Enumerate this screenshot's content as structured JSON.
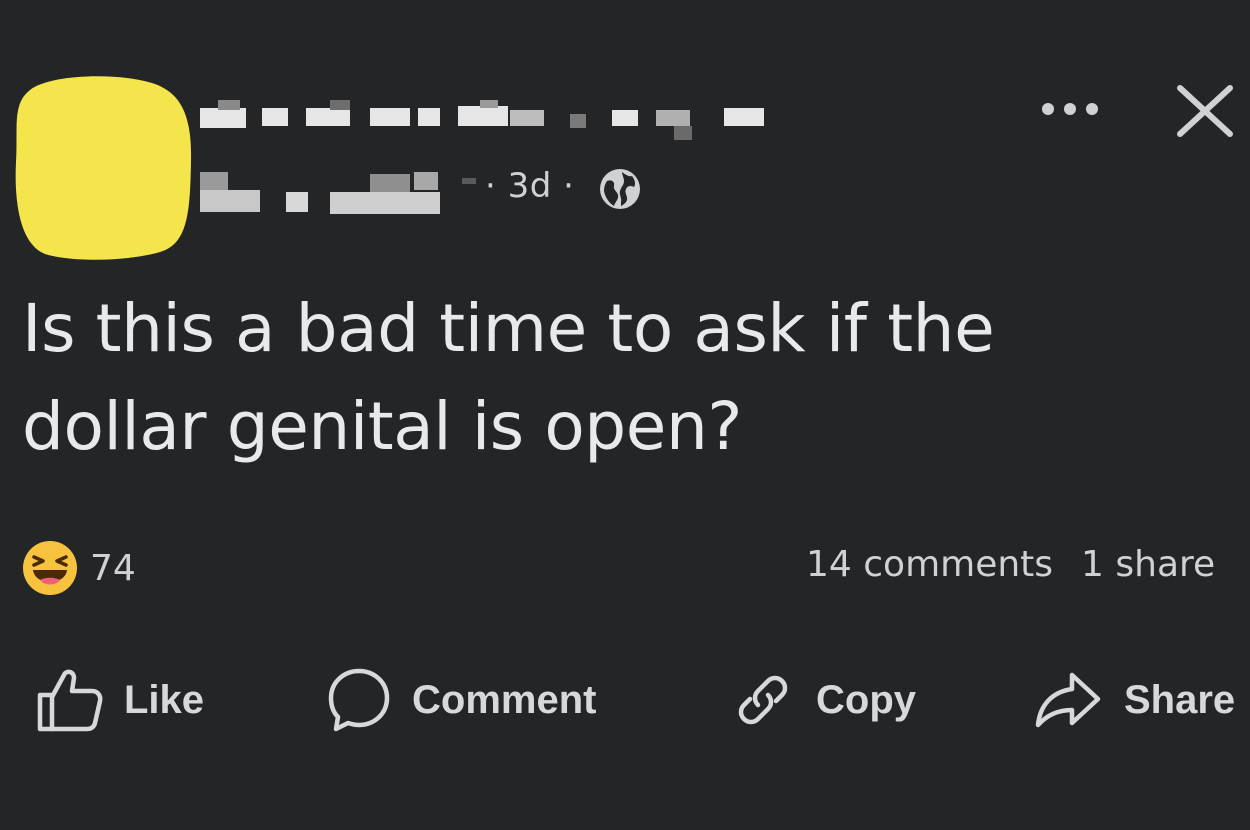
{
  "post": {
    "meta": {
      "time": "3d",
      "separator": "·",
      "privacy_icon": "globe-icon"
    },
    "text_lines": [
      "Is this a bad time to ask if the",
      "dollar genital is open?"
    ],
    "reactions": {
      "icon": "haha-emoji-icon",
      "count": "74"
    },
    "stats": {
      "comments": "14 comments",
      "shares": "1 share"
    },
    "actions": {
      "like": "Like",
      "comment": "Comment",
      "copy": "Copy",
      "share": "Share"
    },
    "header_icons": {
      "more": "more-options-icon",
      "close": "close-icon"
    },
    "colors": {
      "background": "#242526",
      "text": "#e8e9ec",
      "avatar_redaction": "#f5e54c",
      "haha_emoji": "#f7c33f"
    }
  }
}
